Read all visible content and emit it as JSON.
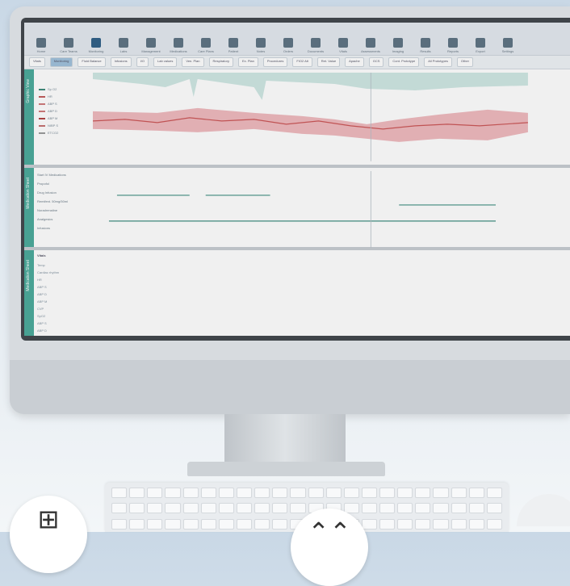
{
  "toolbar": {
    "items": [
      {
        "label": "Home",
        "active": false
      },
      {
        "label": "Care Teams",
        "active": false
      },
      {
        "label": "Monitoring",
        "active": true
      },
      {
        "label": "Labs",
        "active": false
      },
      {
        "label": "Management",
        "active": false
      },
      {
        "label": "Medications",
        "active": false
      },
      {
        "label": "Care Plans",
        "active": false
      },
      {
        "label": "Patient",
        "active": false
      },
      {
        "label": "Notes",
        "active": false
      },
      {
        "label": "Orders",
        "active": false
      },
      {
        "label": "Documents",
        "active": false
      },
      {
        "label": "Vitals",
        "active": false
      },
      {
        "label": "Assessments",
        "active": false
      },
      {
        "label": "Imaging",
        "active": false
      },
      {
        "label": "Results",
        "active": false
      },
      {
        "label": "Reports",
        "active": false
      },
      {
        "label": "Export",
        "active": false
      },
      {
        "label": "Settings",
        "active": false
      }
    ]
  },
  "subbar": {
    "chips": [
      "Vitals",
      "Monitoring",
      "Fluid Balance",
      "Infusions",
      "I/O",
      "Lab values",
      "Ven. Plan",
      "Respiratory",
      "Ex. Plan",
      "Procedures",
      "FIO2 Alt",
      "Ret. Value",
      "Apache",
      "GCS",
      "Cont. Prototype",
      "All Prototypes",
      "Other"
    ]
  },
  "panels": {
    "vitals": {
      "tab_label": "Graphic View",
      "legend": [
        {
          "label": "Sp O2",
          "color": "#3d8a7a"
        },
        {
          "label": "HR",
          "color": "#c15a5a"
        },
        {
          "label": "ABP S",
          "color": "#d07a7a"
        },
        {
          "label": "ABP D",
          "color": "#d07a7a"
        },
        {
          "label": "ABP M",
          "color": "#b04040"
        },
        {
          "label": "NIBP S",
          "color": "#c57070"
        },
        {
          "label": "ETCO2",
          "color": "#9a9a9a"
        }
      ]
    },
    "medications": {
      "tab_label": "Medication Sheet",
      "rows": [
        "Start IV Medications",
        "Propofol",
        "Drug Infusion",
        "Remifent. 50mg/50ml",
        "Noradrenaline",
        "Analgesics",
        "Infusions"
      ]
    },
    "table": {
      "tab_label": "Medication Sheet",
      "header": "Vitals",
      "rows": [
        "Temp",
        "Cardiac rhythm",
        "HR",
        "ABP S",
        "ABP D",
        "ABP M",
        "CVP",
        "SpO2",
        "ABP S",
        "ABP D"
      ]
    }
  }
}
